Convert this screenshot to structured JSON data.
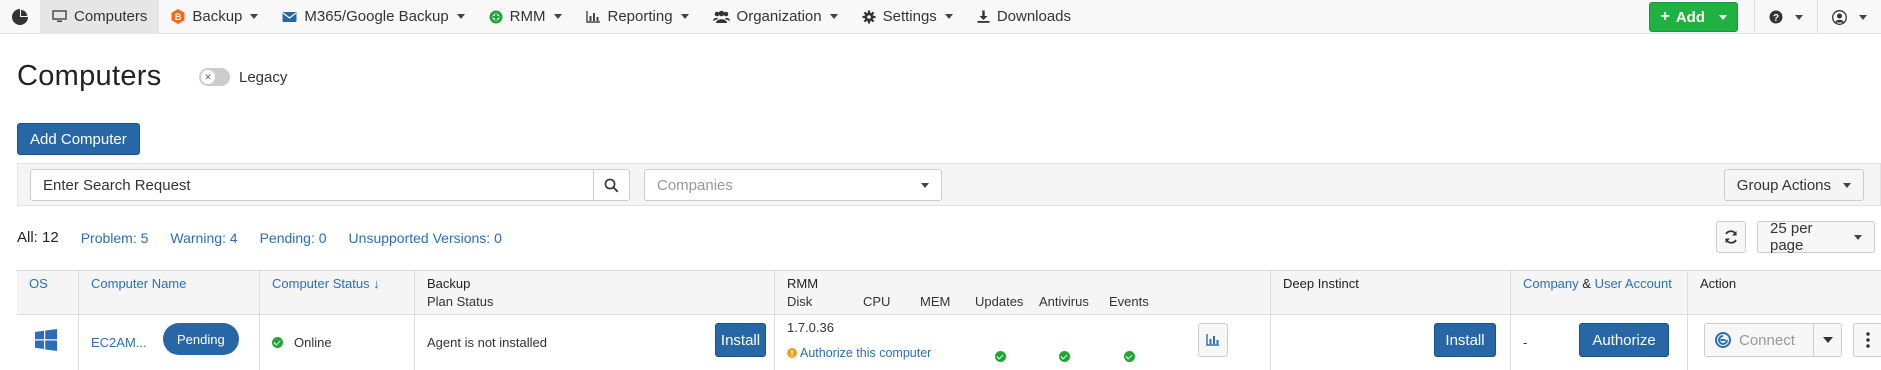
{
  "nav": {
    "items": [
      {
        "label": "Computers",
        "icon": "monitor-icon",
        "active": true
      },
      {
        "label": "Backup",
        "icon": "backup-icon",
        "dropdown": true
      },
      {
        "label": "M365/Google Backup",
        "icon": "envelope-icon",
        "dropdown": true
      },
      {
        "label": "RMM",
        "icon": "rmm-icon",
        "dropdown": true
      },
      {
        "label": "Reporting",
        "icon": "bar-chart-icon",
        "dropdown": true
      },
      {
        "label": "Organization",
        "icon": "users-icon",
        "dropdown": true
      },
      {
        "label": "Settings",
        "icon": "gear-icon",
        "dropdown": true
      },
      {
        "label": "Downloads",
        "icon": "download-icon"
      }
    ],
    "add_label": "Add",
    "help_icon": "question-icon",
    "user_icon": "user-icon"
  },
  "page": {
    "title": "Computers",
    "legacy_label": "Legacy",
    "add_computer_label": "Add Computer"
  },
  "filters": {
    "search_placeholder": "Enter Search Request",
    "companies_placeholder": "Companies",
    "group_actions_label": "Group Actions"
  },
  "stats": {
    "all": "All: 12",
    "problem": "Problem: 5",
    "warning": "Warning: 4",
    "pending": "Pending: 0",
    "unsupported": "Unsupported Versions: 0"
  },
  "pagination": {
    "per_page": "25 per page"
  },
  "table": {
    "headers": {
      "os": "OS",
      "computer_name": "Computer Name",
      "computer_status": "Computer Status ↓",
      "backup": "Backup",
      "backup_sub": "Plan Status",
      "rmm": "RMM",
      "rmm_disk": "Disk",
      "rmm_cpu": "CPU",
      "rmm_mem": "MEM",
      "rmm_updates": "Updates",
      "rmm_antivirus": "Antivirus",
      "rmm_events": "Events",
      "deep_instinct": "Deep Instinct",
      "company": "Company",
      "amp": "&",
      "user_account": "User Account",
      "action": "Action"
    },
    "rows": [
      {
        "os_icon": "windows-icon",
        "computer_name": "EC2AM...",
        "pending_badge": "Pending",
        "status": "Online",
        "backup_status": "Agent is not installed",
        "backup_install": "Install",
        "rmm_version": "1.7.0.36",
        "rmm_warning": "Authorize this computer",
        "deep_instinct_install": "Install",
        "company": "-",
        "authorize": "Authorize",
        "connect": "Connect"
      }
    ]
  },
  "colors": {
    "primary": "#2767a5",
    "success": "#1fb141",
    "link": "#2a6ebb",
    "warning": "#f0a020"
  }
}
